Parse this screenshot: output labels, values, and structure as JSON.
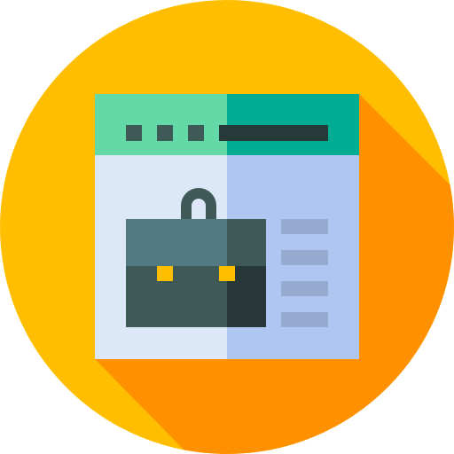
{
  "icon": {
    "name": "job-portal-browser-briefcase-icon",
    "kind": "flat circular badge icon"
  },
  "colors": {
    "circle": "#FFBF00",
    "long_shadow": "#FF9100",
    "window_header_left": "#64D9A8",
    "window_header_right": "#00AD93",
    "window_body_left": "#DCE8F8",
    "window_body_right": "#AFC6F2",
    "header_dots": "#3E5956",
    "address_bar": "#263A3A",
    "briefcase_top_left": "#537A82",
    "briefcase_top_right": "#3E5956",
    "briefcase_bottom_left": "#3E5956",
    "briefcase_bottom_right": "#283838",
    "briefcase_handle": "#3E5956",
    "briefcase_clasps": "#FFBF00",
    "text_lines": "#97AACF"
  },
  "window": {
    "header_dots_count": 3,
    "text_lines_count": 4
  }
}
